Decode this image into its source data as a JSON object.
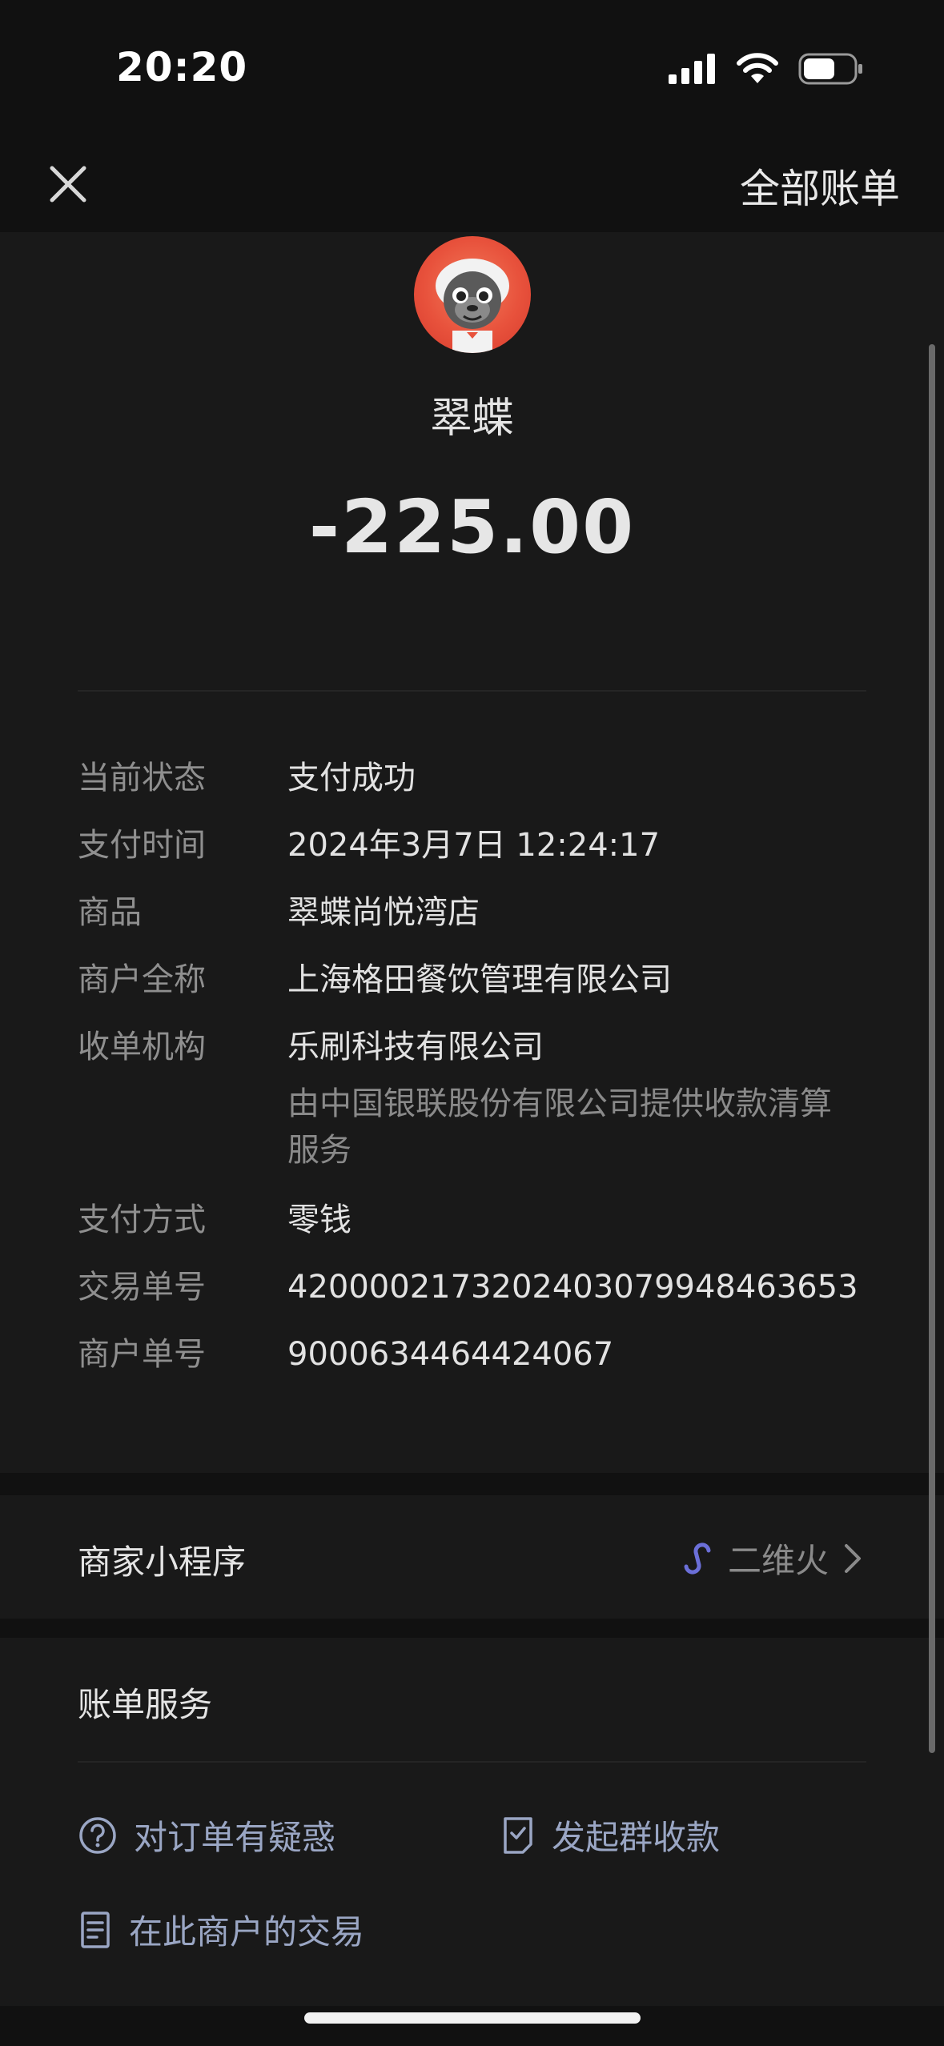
{
  "status_bar": {
    "time": "20:20"
  },
  "header": {
    "all_bills_label": "全部账单"
  },
  "merchant": {
    "name": "翠蝶",
    "amount": "-225.00"
  },
  "details": [
    {
      "label": "当前状态",
      "value": "支付成功"
    },
    {
      "label": "支付时间",
      "value": "2024年3月7日 12:24:17"
    },
    {
      "label": "商品",
      "value": "翠蝶尚悦湾店"
    },
    {
      "label": "商户全称",
      "value": "上海格田餐饮管理有限公司"
    },
    {
      "label": "收单机构",
      "value": "乐刷科技有限公司",
      "note": "由中国银联股份有限公司提供收款清算服务"
    },
    {
      "label": "支付方式",
      "value": "零钱"
    },
    {
      "label": "交易单号",
      "value": "4200002173202403079948463653"
    },
    {
      "label": "商户单号",
      "value": "9000634464424067"
    }
  ],
  "mini_program": {
    "label": "商家小程序",
    "name": "二维火"
  },
  "bill_services": {
    "title": "账单服务",
    "items": [
      {
        "label": "对订单有疑惑",
        "icon": "question-circle-icon"
      },
      {
        "label": "发起群收款",
        "icon": "document-check-icon"
      },
      {
        "label": "在此商户的交易",
        "icon": "document-list-icon"
      }
    ]
  },
  "colors": {
    "background": "#111111",
    "card": "#191919",
    "link": "#9aa6c4",
    "mini_program_icon": "#6b6fd8"
  }
}
